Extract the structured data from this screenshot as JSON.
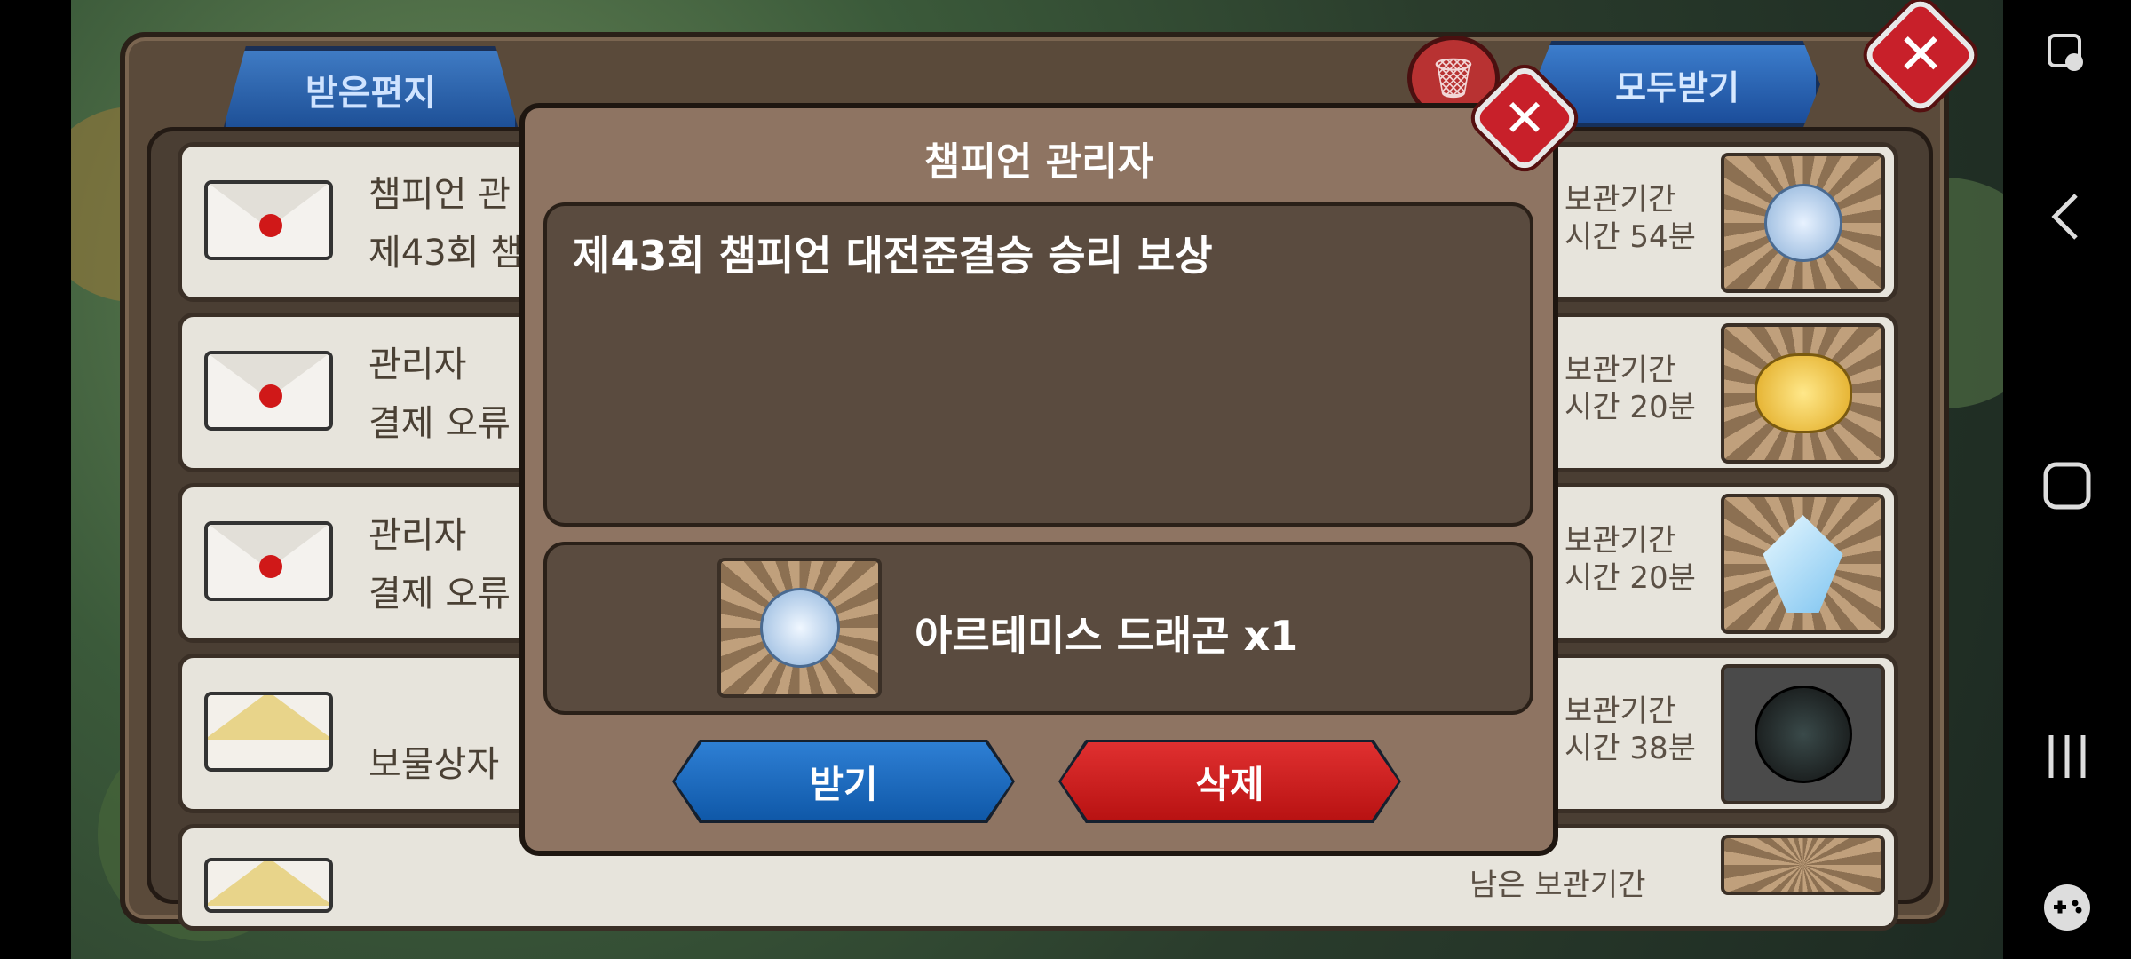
{
  "mailbox": {
    "tab_label": "받은편지",
    "receive_all_label": "모두받기",
    "trash_icon": "trash-icon",
    "close_icon": "close-icon",
    "rows": [
      {
        "line1": "챔피언 관",
        "line2": "제43회 챔",
        "right1": "보관기간",
        "right2": "시간 54분",
        "envelope": "mail-red-seal"
      },
      {
        "line1": "관리자",
        "line2": "결제 오류",
        "right1": "보관기간",
        "right2": "시간 20분",
        "envelope": "mail-red-seal"
      },
      {
        "line1": "관리자",
        "line2": "결제 오류",
        "right1": "보관기간",
        "right2": "시간 20분",
        "envelope": "mail-red-seal"
      },
      {
        "line1": "",
        "line2": "보물상자",
        "right1": "보관기간",
        "right2": "시간 38분",
        "envelope": "mail-yellow"
      },
      {
        "line1": "",
        "line2": "",
        "right1": "남은 보관기간",
        "right2": "",
        "envelope": "mail-yellow"
      }
    ]
  },
  "dialog": {
    "title": "챔피언 관리자",
    "message": "제43회 챔피언 대전준결승 승리 보상",
    "reward_text": "아르테미스 드래곤 x1",
    "receive_label": "받기",
    "delete_label": "삭제",
    "close_icon": "close-icon"
  },
  "navbar": {
    "icons": [
      "accessibility-icon",
      "back-icon",
      "home-icon",
      "recents-icon",
      "game-controller-icon"
    ]
  },
  "colors": {
    "receive_blue": "#1768c0",
    "delete_red": "#d01f1f",
    "close_red": "#c8202a",
    "panel_brown": "#8e7462"
  }
}
